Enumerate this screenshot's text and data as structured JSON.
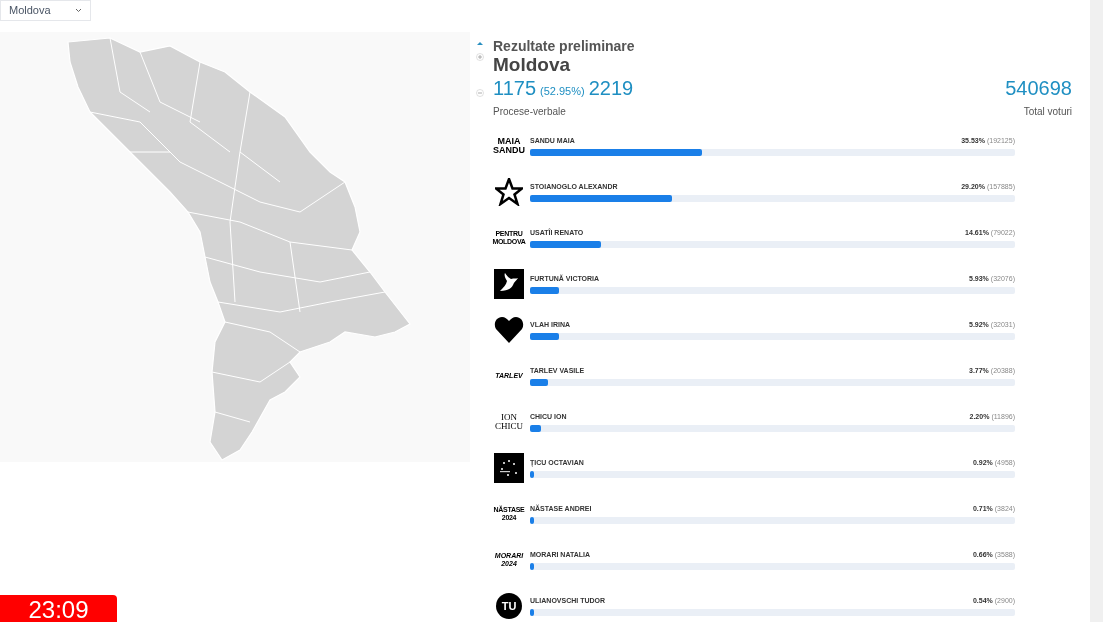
{
  "region_select": {
    "value": "Moldova"
  },
  "header": {
    "title": "Rezultate preliminare",
    "region": "Moldova",
    "counted": "1175",
    "counted_share": "(52.95%)",
    "total_reports": "2219",
    "reports_label": "Procese-verbale",
    "total_votes": "540698",
    "votes_label": "Total voturi"
  },
  "candidates": [
    {
      "name": "SANDU MAIA",
      "percent": "35.53%",
      "votes": "(192125)",
      "level": 0.3553,
      "kind": "text",
      "logo_text": "MAIA SANDU"
    },
    {
      "name": "STOIANOGLO ALEXANDR",
      "percent": "29.20%",
      "votes": "(157885)",
      "level": 0.292,
      "kind": "star"
    },
    {
      "name": "USATÎI RENATO",
      "percent": "14.61%",
      "votes": "(79022)",
      "level": 0.1461,
      "kind": "small_text",
      "logo_text": "PENTRU MOLDOVA"
    },
    {
      "name": "FURTUNĂ VICTORIA",
      "percent": "5.93%",
      "votes": "(32076)",
      "level": 0.0593,
      "kind": "dove"
    },
    {
      "name": "VLAH IRINA",
      "percent": "5.92%",
      "votes": "(32031)",
      "level": 0.0592,
      "kind": "heart"
    },
    {
      "name": "TARLEV VASILE",
      "percent": "3.77%",
      "votes": "(20388)",
      "level": 0.0377,
      "kind": "italic_text",
      "logo_text": "TARLEV"
    },
    {
      "name": "CHICU ION",
      "percent": "2.20%",
      "votes": "(11896)",
      "level": 0.022,
      "kind": "serif_text",
      "logo_text": "ION CHICU"
    },
    {
      "name": "ȚICU OCTAVIAN",
      "percent": "0.92%",
      "votes": "(4958)",
      "level": 0.0092,
      "kind": "stars_square"
    },
    {
      "name": "NĂSTASE ANDREI",
      "percent": "0.71%",
      "votes": "(3824)",
      "level": 0.0071,
      "kind": "small_text",
      "logo_text": "NĂSTASE 2024"
    },
    {
      "name": "MORARI NATALIA",
      "percent": "0.66%",
      "votes": "(3588)",
      "level": 0.0066,
      "kind": "italic_text",
      "logo_text": "MORARI 2024"
    },
    {
      "name": "ULIANOVSCHI TUDOR",
      "percent": "0.54%",
      "votes": "(2900)",
      "level": 0.0054,
      "kind": "circle_text",
      "logo_text": "TU"
    }
  ],
  "clock": "23:09"
}
